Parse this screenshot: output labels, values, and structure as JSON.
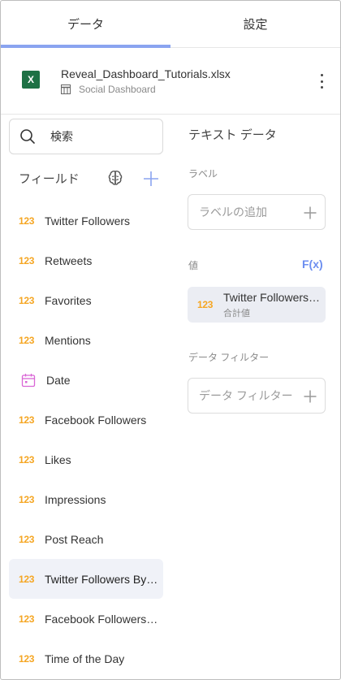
{
  "tabs": [
    {
      "label": "データ",
      "active": true
    },
    {
      "label": "設定",
      "active": false
    }
  ],
  "file": {
    "icon": "excel-file-icon",
    "name": "Reveal_Dashboard_Tutorials.xlsx",
    "sheet": "Social Dashboard"
  },
  "search": {
    "placeholder": "検索"
  },
  "fields": {
    "title": "フィールド",
    "items": [
      {
        "label": "Twitter Followers",
        "type": "number",
        "icon_text": "123"
      },
      {
        "label": "Retweets",
        "type": "number",
        "icon_text": "123"
      },
      {
        "label": "Favorites",
        "type": "number",
        "icon_text": "123"
      },
      {
        "label": "Mentions",
        "type": "number",
        "icon_text": "123"
      },
      {
        "label": "Date",
        "type": "date",
        "icon_text": ""
      },
      {
        "label": "Facebook Followers",
        "type": "number",
        "icon_text": "123"
      },
      {
        "label": "Likes",
        "type": "number",
        "icon_text": "123"
      },
      {
        "label": "Impressions",
        "type": "number",
        "icon_text": "123"
      },
      {
        "label": "Post Reach",
        "type": "number",
        "icon_text": "123"
      },
      {
        "label": "Twitter Followers By Day",
        "type": "number",
        "icon_text": "123",
        "selected": true
      },
      {
        "label": "Facebook Followers By Day",
        "type": "number",
        "icon_text": "123"
      },
      {
        "label": "Time of the Day",
        "type": "number",
        "icon_text": "123"
      }
    ]
  },
  "editor": {
    "title": "テキスト データ",
    "label_section": "ラベル",
    "label_placeholder": "ラベルの追加",
    "value_section": "値",
    "fx_label": "F(x)",
    "value_item": {
      "icon_text": "123",
      "name": "Twitter Followers By Day",
      "aggregation": "合計値"
    },
    "filter_section": "データ フィルター",
    "filter_placeholder": "データ フィルター"
  },
  "colors": {
    "accent": "#8aa4f0",
    "number_icon": "#f5a623",
    "date_icon": "#d966d6",
    "excel_green": "#1e7145",
    "fx": "#6c8ef0"
  }
}
